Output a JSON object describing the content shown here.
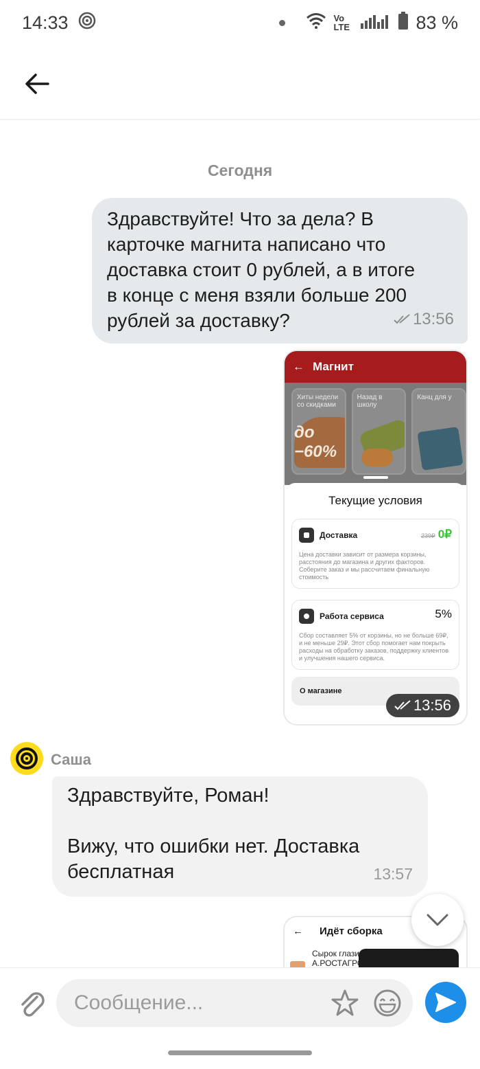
{
  "status_bar": {
    "time": "14:33",
    "network": "Vo LTE",
    "battery": "83 %"
  },
  "header": {
    "back_icon": "arrow-left-icon"
  },
  "chat": {
    "date_separator": "Сегодня",
    "outgoing_message": {
      "lines": [
        "Здравствуйте! Что за дела? В",
        "карточке магнита написано что",
        "доставка стоит 0 рублей, а в итоге",
        "в конце с меня взяли больше 200",
        "рублей за доставку?"
      ],
      "time": "13:56",
      "status_icon": "double-check-icon"
    },
    "image_message": {
      "app_title": "Магнит",
      "tiles": [
        "Хиты недели со скидками",
        "Назад в школу",
        "Канц для у"
      ],
      "sale_badge": "до −60%",
      "sheet_title": "Текущие условия",
      "delivery": {
        "label": "Доставка",
        "old_price": "239₽",
        "price": "0₽",
        "description": "Цена доставки зависит от размера корзины, расстояния до магазина и других факторов. Соберите заказ и мы рассчитаем финальную стоимость"
      },
      "service": {
        "label": "Работа сервиса",
        "percent": "5%",
        "description": "Сбор составляет 5% от корзины, но не больше 69₽, и не меньше 29₽. Этот сбор помогает нам покрыть расходы на обработку заказов, поддержку клиентов и улучшения нашего сервиса."
      },
      "store_row": "О магазине",
      "time": "13:56"
    },
    "incoming_message": {
      "sender": "Саша",
      "line1": "Здравствуйте, Роман!",
      "line2": "Вижу, что ошибки нет. Доставка",
      "line3": "бесплатная",
      "time": "13:57"
    },
    "image_message_2": {
      "title": "Идёт сборка",
      "item_line1": "Сырок глази",
      "item_line2": "А.РОСТАГРО"
    }
  },
  "composer": {
    "placeholder": "Сообщение..."
  },
  "colors": {
    "send_button": "#1d8fe8",
    "outgoing_bubble": "#e6e9ec",
    "incoming_bubble": "#f2f2f2",
    "avatar": "#ffdb1e"
  }
}
